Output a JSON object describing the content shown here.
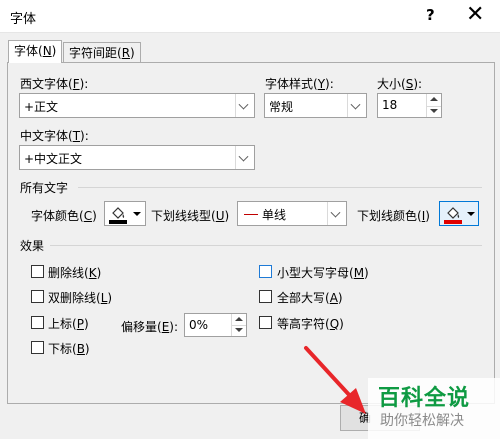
{
  "window": {
    "title": "字体",
    "help": "?",
    "close": "✕"
  },
  "tabs": [
    {
      "label": "字体(",
      "key": "N",
      "tail": ")"
    },
    {
      "label": "字符间距(",
      "key": "R",
      "tail": ")"
    }
  ],
  "western_font": {
    "label": "西文字体(",
    "key": "F",
    "tail": "):",
    "value": "+正文"
  },
  "font_style": {
    "label": "字体样式(",
    "key": "Y",
    "tail": "):",
    "value": "常规"
  },
  "font_size": {
    "label": "大小(",
    "key": "S",
    "tail": "):",
    "value": "18"
  },
  "chinese_font": {
    "label": "中文字体(",
    "key": "T",
    "tail": "):",
    "value": "+中文正文"
  },
  "all_text": {
    "section": "所有文字",
    "font_color": {
      "label": "字体颜色(",
      "key": "C",
      "tail": ")"
    },
    "underline_type": {
      "label": "下划线线型(",
      "key": "U",
      "tail": ")",
      "value": "单线"
    },
    "underline_color": {
      "label": "下划线颜色(",
      "key": "I",
      "tail": ")"
    }
  },
  "effects": {
    "section": "效果",
    "strikethrough": {
      "label": "删除线(",
      "key": "K",
      "tail": ")"
    },
    "double_strikethrough": {
      "label": "双删除线(",
      "key": "L",
      "tail": ")"
    },
    "superscript": {
      "label": "上标(",
      "key": "P",
      "tail": ")"
    },
    "subscript": {
      "label": "下标(",
      "key": "B",
      "tail": ")"
    },
    "offset": {
      "label": "偏移量(",
      "key": "E",
      "tail": "):",
      "value": "0%"
    },
    "small_caps": {
      "label": "小型大写字母(",
      "key": "M",
      "tail": ")"
    },
    "all_caps": {
      "label": "全部大写(",
      "key": "A",
      "tail": ")"
    },
    "equalize_height": {
      "label": "等高字符(",
      "key": "Q",
      "tail": ")"
    }
  },
  "buttons": {
    "ok_partial": "确"
  },
  "watermark": {
    "main": "百科全说",
    "sub": "助你轻松解决"
  },
  "colors": {
    "arrow": "#e8262a",
    "font_color_swatch": "#000000",
    "underline_color_swatch": "#e00000",
    "selected_border": "#0078d7",
    "watermark_green": "#0e9a42"
  }
}
